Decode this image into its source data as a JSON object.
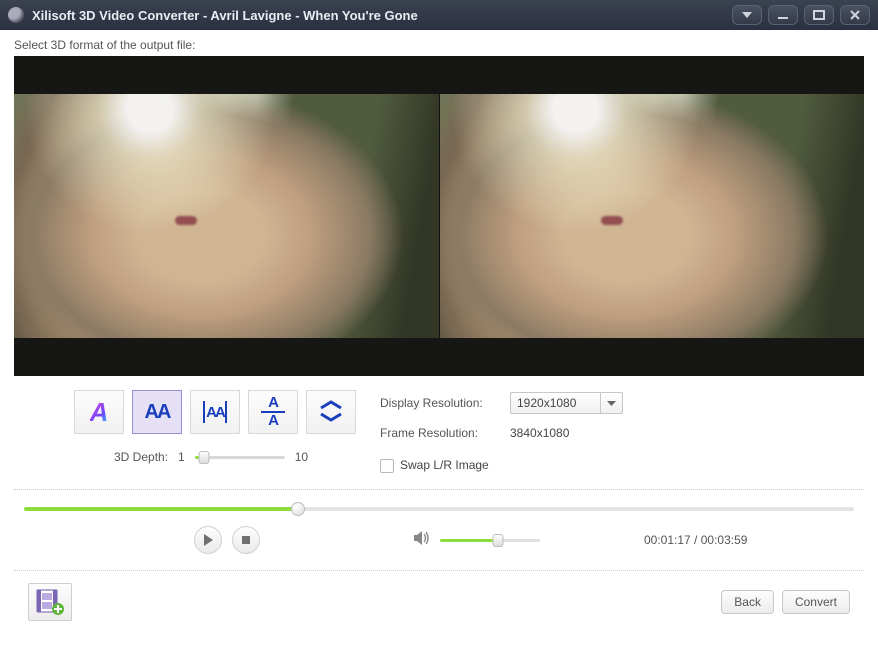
{
  "window": {
    "title": "Xilisoft 3D Video Converter - Avril Lavigne - When You're Gone"
  },
  "hint": "Select 3D format of the output file:",
  "formats": {
    "anaglyph": "A",
    "sbs_full": "AA",
    "sbs_half": "AA",
    "tb_top": "A",
    "tb_bottom": "A"
  },
  "depth": {
    "label": "3D Depth:",
    "min": "1",
    "max": "10"
  },
  "display_resolution": {
    "label": "Display Resolution:",
    "value": "1920x1080"
  },
  "frame_resolution": {
    "label": "Frame Resolution:",
    "value": "3840x1080"
  },
  "swap": {
    "label": "Swap L/R Image"
  },
  "time": {
    "elapsed": "00:01:17",
    "sep": " / ",
    "total": "00:03:59"
  },
  "footer": {
    "back": "Back",
    "convert": "Convert"
  }
}
